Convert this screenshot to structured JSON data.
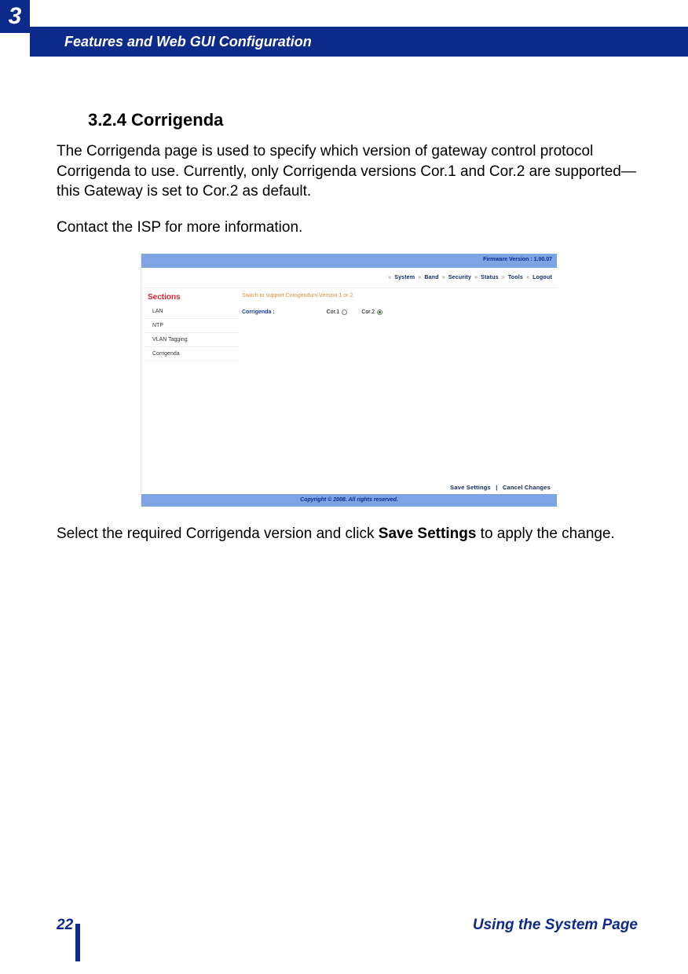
{
  "chapter_number": "3",
  "header_title": "Features and Web GUI Configuration",
  "section_heading": "3.2.4 Corrigenda",
  "para1": "The Corrigenda page is used to specify which version of gateway control proto­col Corrigenda to use. Currently, only Corrigenda versions Cor.1 and Cor.2 are supported—this Gateway is set to Cor.2 as default.",
  "para2": "Contact the ISP for more information.",
  "para3_pre": "Select the required Corrigenda version and click ",
  "para3_strong": "Save Settings",
  "para3_post": " to apply the change.",
  "screenshot": {
    "firmware_label": "Firmware Version : 1.00.07",
    "nav": {
      "i1": "System",
      "i2": "Band",
      "i3": "Security",
      "i4": "Status",
      "i5": "Tools",
      "i6": "Logout"
    },
    "sidebar": {
      "title": "Sections",
      "items": {
        "a": "LAN",
        "b": "NTP",
        "c": "VLAN Tagging",
        "d": "Corrigenda"
      }
    },
    "hint": "Switch to support Corrigendum Version 1 or 2.",
    "field_label": "Corrigenda :",
    "opt1": "Cor.1",
    "opt2": "Cor.2",
    "save": "Save Settings",
    "cancel": "Cancel Changes",
    "copyright": "Copyright © 2008.  All rights reserved."
  },
  "footer": {
    "page_number": "22",
    "title": "Using the System Page"
  }
}
